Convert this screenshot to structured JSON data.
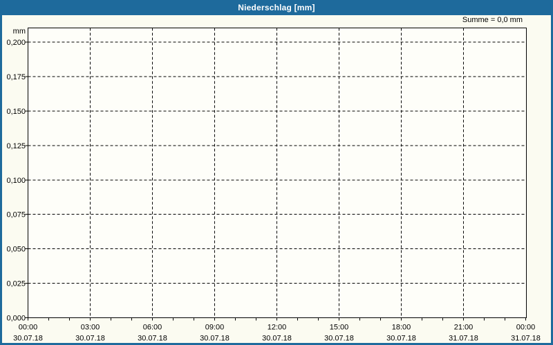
{
  "titlebar": {
    "title": "Niederschlag [mm]"
  },
  "header": {
    "summary": "Summe = 0,0 mm"
  },
  "colors": {
    "accent_blue": "#1E6A9C",
    "window_border": "#1E6A9C",
    "background": "#FBFBF1",
    "plot_background": "#FEFEF9",
    "grid": "#000000",
    "axis": "#000000",
    "text": "#000000",
    "title_text": "#FFFFFF"
  },
  "chart_data": {
    "type": "bar",
    "title": "Niederschlag [mm]",
    "ylabel": "mm",
    "xlabel": "",
    "ylim": [
      0,
      0.21
    ],
    "ytick_step": 0.025,
    "grid": true,
    "grid_style": "dashed",
    "legend": "none",
    "summary_annotation": "Summe = 0,0 mm",
    "y_ticks": [
      {
        "value": 0.0,
        "label": "0,000"
      },
      {
        "value": 0.025,
        "label": "0,025"
      },
      {
        "value": 0.05,
        "label": "0,050"
      },
      {
        "value": 0.075,
        "label": "0,075"
      },
      {
        "value": 0.1,
        "label": "0,100"
      },
      {
        "value": 0.125,
        "label": "0,125"
      },
      {
        "value": 0.15,
        "label": "0,150"
      },
      {
        "value": 0.175,
        "label": "0,175"
      },
      {
        "value": 0.2,
        "label": "0,200"
      }
    ],
    "x_ticks": [
      {
        "hour": 0,
        "time": "00:00",
        "date": "30.07.18"
      },
      {
        "hour": 3,
        "time": "03:00",
        "date": "30.07.18"
      },
      {
        "hour": 6,
        "time": "06:00",
        "date": "30.07.18"
      },
      {
        "hour": 9,
        "time": "09:00",
        "date": "30.07.18"
      },
      {
        "hour": 12,
        "time": "12:00",
        "date": "30.07.18"
      },
      {
        "hour": 15,
        "time": "15:00",
        "date": "30.07.18"
      },
      {
        "hour": 18,
        "time": "18:00",
        "date": "30.07.18"
      },
      {
        "hour": 21,
        "time": "21:00",
        "date": "31.07.18"
      },
      {
        "hour": 24,
        "time": "00:00",
        "date": "31.07.18"
      }
    ],
    "x_total_hours": 24,
    "x_minor_tick_every_hours": 1,
    "grid_hours": [
      3,
      6,
      9,
      12,
      15,
      18,
      21
    ],
    "series": [
      {
        "name": "Niederschlag",
        "values": [],
        "total_mm": "0,0"
      }
    ]
  }
}
